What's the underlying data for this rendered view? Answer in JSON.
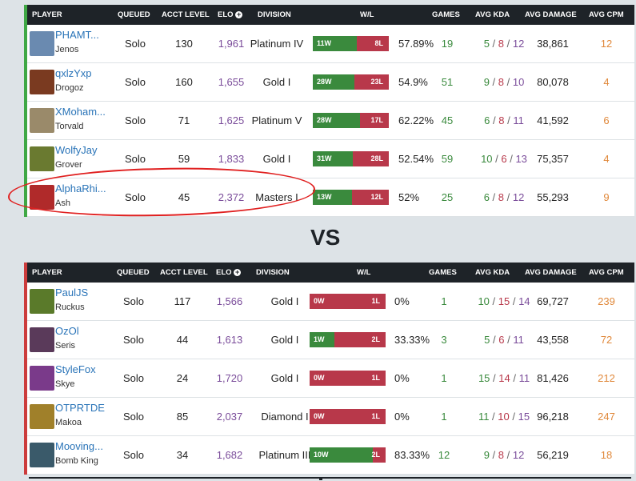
{
  "headers": {
    "player": "PLAYER",
    "queued": "QUEUED",
    "acct_level": "ACCT LEVEL",
    "elo": "ELO",
    "division": "DIVISION",
    "wl": "W/L",
    "games": "GAMES",
    "avg_kda": "AVG KDA",
    "avg_damage": "AVG DAMAGE",
    "avg_cpm": "AVG CPM"
  },
  "vs": "VS",
  "team1": [
    {
      "name": "PHAMT...",
      "hero": "Jenos",
      "queued": "Solo",
      "level": "130",
      "elo": "1,961",
      "division": "Platinum IV",
      "wins": "11W",
      "losses": "8L",
      "win_frac": 0.58,
      "winrate": "57.89%",
      "games": "19",
      "k": "5",
      "d": "8",
      "a": "12",
      "damage": "38,861",
      "cpm": "12",
      "avatar_color": "#6a8ab0"
    },
    {
      "name": "qxlzYxp",
      "hero": "Drogoz",
      "queued": "Solo",
      "level": "160",
      "elo": "1,655",
      "division": "Gold I",
      "wins": "28W",
      "losses": "23L",
      "win_frac": 0.55,
      "winrate": "54.9%",
      "games": "51",
      "k": "9",
      "d": "8",
      "a": "10",
      "damage": "80,078",
      "cpm": "4",
      "avatar_color": "#7a3a20"
    },
    {
      "name": "XMoham...",
      "hero": "Torvald",
      "queued": "Solo",
      "level": "71",
      "elo": "1,625",
      "division": "Platinum V",
      "wins": "28W",
      "losses": "17L",
      "win_frac": 0.62,
      "winrate": "62.22%",
      "games": "45",
      "k": "6",
      "d": "8",
      "a": "11",
      "damage": "41,592",
      "cpm": "6",
      "avatar_color": "#9a8a6a"
    },
    {
      "name": "WolfyJay",
      "hero": "Grover",
      "queued": "Solo",
      "level": "59",
      "elo": "1,833",
      "division": "Gold I",
      "wins": "31W",
      "losses": "28L",
      "win_frac": 0.53,
      "winrate": "52.54%",
      "games": "59",
      "k": "10",
      "d": "6",
      "a": "13",
      "damage": "75,357",
      "cpm": "4",
      "avatar_color": "#6a7a30"
    },
    {
      "name": "AlphaRhi...",
      "hero": "Ash",
      "queued": "Solo",
      "level": "45",
      "elo": "2,372",
      "division": "Masters I",
      "wins": "13W",
      "losses": "12L",
      "win_frac": 0.52,
      "winrate": "52%",
      "games": "25",
      "k": "6",
      "d": "8",
      "a": "12",
      "damage": "55,293",
      "cpm": "9",
      "avatar_color": "#b02a2a"
    }
  ],
  "team2": [
    {
      "name": "PaulJS",
      "hero": "Ruckus",
      "queued": "Solo",
      "level": "117",
      "elo": "1,566",
      "division": "Gold I",
      "wins": "0W",
      "losses": "1L",
      "win_frac": 0,
      "winrate": "0%",
      "games": "1",
      "k": "10",
      "d": "15",
      "a": "14",
      "damage": "69,727",
      "cpm": "239",
      "avatar_color": "#5a7a2a"
    },
    {
      "name": "OzOl",
      "hero": "Seris",
      "queued": "Solo",
      "level": "44",
      "elo": "1,613",
      "division": "Gold I",
      "wins": "1W",
      "losses": "2L",
      "win_frac": 0.33,
      "winrate": "33.33%",
      "games": "3",
      "k": "5",
      "d": "6",
      "a": "11",
      "damage": "43,558",
      "cpm": "72",
      "avatar_color": "#5a3a5a"
    },
    {
      "name": "StyleFox",
      "hero": "Skye",
      "queued": "Solo",
      "level": "24",
      "elo": "1,720",
      "division": "Gold I",
      "wins": "0W",
      "losses": "1L",
      "win_frac": 0,
      "winrate": "0%",
      "games": "1",
      "k": "15",
      "d": "14",
      "a": "11",
      "damage": "81,426",
      "cpm": "212",
      "avatar_color": "#7a3a8a"
    },
    {
      "name": "OTPRTDE",
      "hero": "Makoa",
      "queued": "Solo",
      "level": "85",
      "elo": "2,037",
      "division": "Diamond I",
      "wins": "0W",
      "losses": "1L",
      "win_frac": 0,
      "winrate": "0%",
      "games": "1",
      "k": "11",
      "d": "10",
      "a": "15",
      "damage": "96,218",
      "cpm": "247",
      "avatar_color": "#a0802a"
    },
    {
      "name": "Mooving...",
      "hero": "Bomb King",
      "queued": "Solo",
      "level": "34",
      "elo": "1,682",
      "division": "Platinum III",
      "wins": "10W",
      "losses": "2L",
      "win_frac": 0.83,
      "winrate": "83.33%",
      "games": "12",
      "k": "9",
      "d": "8",
      "a": "12",
      "damage": "56,219",
      "cpm": "18",
      "avatar_color": "#3a5a6a"
    }
  ]
}
